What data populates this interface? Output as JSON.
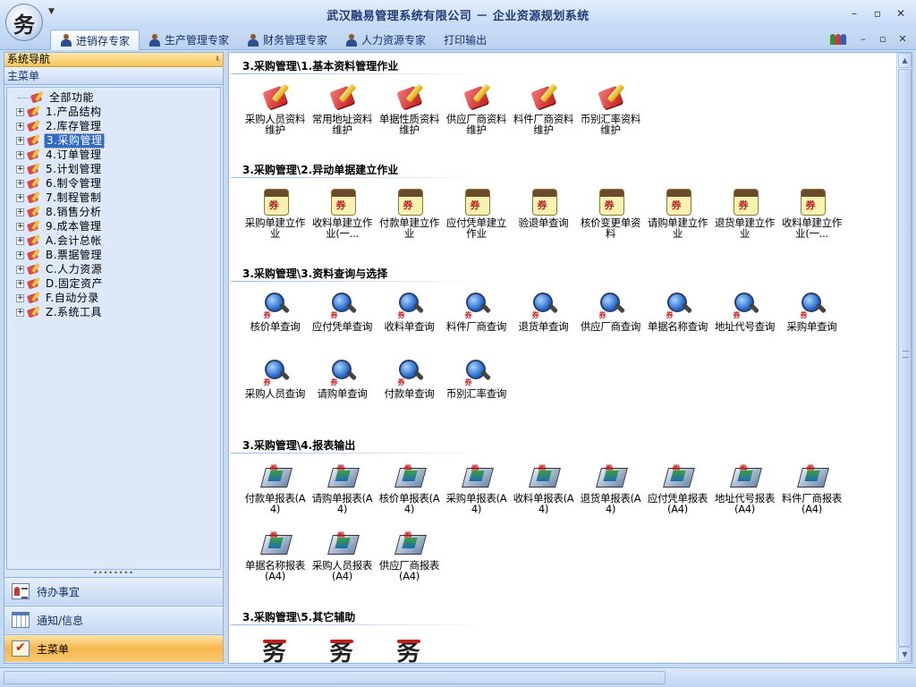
{
  "window": {
    "title": "武汉融易管理系统有限公司 － 企业资源规划系统",
    "logo_glyph": "务",
    "controls": [
      "–",
      "▫",
      "✕"
    ]
  },
  "ribbon": {
    "tabs": [
      {
        "label": "进销存专家",
        "active": true,
        "has_icon": true
      },
      {
        "label": "生产管理专家",
        "active": false,
        "has_icon": true
      },
      {
        "label": "财务管理专家",
        "active": false,
        "has_icon": true
      },
      {
        "label": "人力资源专家",
        "active": false,
        "has_icon": true
      },
      {
        "label": "打印输出",
        "active": false,
        "has_icon": false
      }
    ],
    "right_controls": [
      "–",
      "▫",
      "✕"
    ]
  },
  "sidebar": {
    "header": "系统导航",
    "pin": "♮",
    "menu_title": "主菜单",
    "tree": [
      {
        "label": "全部功能",
        "expandable": false,
        "selected": false
      },
      {
        "label": "1.产品结构",
        "expandable": true,
        "selected": false
      },
      {
        "label": "2.库存管理",
        "expandable": true,
        "selected": false
      },
      {
        "label": "3.采购管理",
        "expandable": true,
        "selected": true
      },
      {
        "label": "4.订单管理",
        "expandable": true,
        "selected": false
      },
      {
        "label": "5.计划管理",
        "expandable": true,
        "selected": false
      },
      {
        "label": "6.制令管理",
        "expandable": true,
        "selected": false
      },
      {
        "label": "7.制程管制",
        "expandable": true,
        "selected": false
      },
      {
        "label": "8.销售分析",
        "expandable": true,
        "selected": false
      },
      {
        "label": "9.成本管理",
        "expandable": true,
        "selected": false
      },
      {
        "label": "A.会计总帐",
        "expandable": true,
        "selected": false
      },
      {
        "label": "B.票据管理",
        "expandable": true,
        "selected": false
      },
      {
        "label": "C.人力资源",
        "expandable": true,
        "selected": false
      },
      {
        "label": "D.固定资产",
        "expandable": true,
        "selected": false
      },
      {
        "label": "F.自动分录",
        "expandable": true,
        "selected": false
      },
      {
        "label": "Z.系统工具",
        "expandable": true,
        "selected": false
      }
    ],
    "grip": "••••••••",
    "buttons": [
      {
        "label": "待办事宜",
        "icon": "contact-card-icon",
        "active": false
      },
      {
        "label": "通知/信息",
        "icon": "calendar-icon",
        "active": false
      },
      {
        "label": "主菜单",
        "icon": "checklist-icon",
        "active": true
      }
    ]
  },
  "main": {
    "sections": [
      {
        "title": "3.采购管理\\1.基本资料管理作业",
        "icon": "edit-doc-icon",
        "items": [
          "采购人员资料维护",
          "常用地址资料维护",
          "单据性质资料维护",
          "供应厂商资料维护",
          "料件厂商资料维护",
          "币别汇率资料维护"
        ]
      },
      {
        "title": "3.采购管理\\2.异动单据建立作业",
        "icon": "voucher-icon",
        "items": [
          "采购单建立作业",
          "收料单建立作业(一...",
          "付款单建立作业",
          "应付凭单建立作业",
          "验退单查询",
          "核价变更单资料",
          "请购单建立作业",
          "退货单建立作业",
          "收料单建立作业(一..."
        ]
      },
      {
        "title": "3.采购管理\\3.资料查询与选择",
        "icon": "magnifier-icon",
        "items": [
          "核价单查询",
          "应付凭单查询",
          "收料单查询",
          "料件厂商查询",
          "退货单查询",
          "供应厂商查询",
          "单据名称查询",
          "地址代号查询",
          "采购单查询",
          "采购人员查询",
          "请购单查询",
          "付款单查询",
          "币别汇率查询"
        ]
      },
      {
        "title": "3.采购管理\\4.报表输出",
        "icon": "report-icon",
        "items": [
          "付款单报表(A4)",
          "请购单报表(A4)",
          "核价单报表(A4)",
          "采购单报表(A4)",
          "收料单报表(A4)",
          "退货单报表(A4)",
          "应付凭单报表(A4)",
          "地址代号报表(A4)",
          "料件厂商报表(A4)",
          "单据名称报表(A4)",
          "采购人员报表(A4)",
          "供应厂商报表(A4)"
        ]
      },
      {
        "title": "3.采购管理\\5.其它辅助",
        "icon": "app-logo-icon",
        "items": [
          "",
          "",
          ""
        ]
      }
    ]
  }
}
